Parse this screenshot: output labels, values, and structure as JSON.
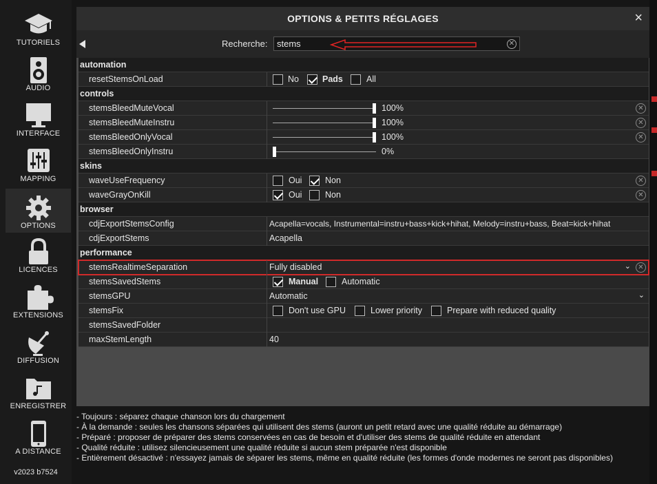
{
  "sidebar": {
    "items": [
      {
        "label": "TUTORIELS"
      },
      {
        "label": "AUDIO"
      },
      {
        "label": "INTERFACE"
      },
      {
        "label": "MAPPING"
      },
      {
        "label": "OPTIONS"
      },
      {
        "label": "LICENCES"
      },
      {
        "label": "EXTENSIONS"
      },
      {
        "label": "DIFFUSION"
      },
      {
        "label": "ENREGISTRER"
      },
      {
        "label": "A DISTANCE"
      }
    ],
    "version": "v2023 b7524"
  },
  "dialog": {
    "title": "OPTIONS & PETITS RÉGLAGES",
    "close": "×",
    "search_label": "Recherche:",
    "search_value": "stems",
    "search_clear": "✕"
  },
  "sections": {
    "automation": "automation",
    "controls": "controls",
    "skins": "skins",
    "browser": "browser",
    "performance": "performance"
  },
  "rows": {
    "resetStemsOnLoad": {
      "name": "resetStemsOnLoad",
      "opt1": "No",
      "opt2": "Pads",
      "opt3": "All"
    },
    "stemsBleedMuteVocal": {
      "name": "stemsBleedMuteVocal",
      "value": "100%",
      "level": 1.0
    },
    "stemsBleedMuteInstru": {
      "name": "stemsBleedMuteInstru",
      "value": "100%",
      "level": 1.0
    },
    "stemsBleedOnlyVocal": {
      "name": "stemsBleedOnlyVocal",
      "value": "100%",
      "level": 1.0
    },
    "stemsBleedOnlyInstru": {
      "name": "stemsBleedOnlyInstru",
      "value": "0%",
      "level": 0.0
    },
    "waveUseFrequency": {
      "name": "waveUseFrequency",
      "opt1": "Oui",
      "opt2": "Non"
    },
    "waveGrayOnKill": {
      "name": "waveGrayOnKill",
      "opt1": "Oui",
      "opt2": "Non"
    },
    "cdjExportStemsConfig": {
      "name": "cdjExportStemsConfig",
      "value": "Acapella=vocals, Instrumental=instru+bass+kick+hihat, Melody=instru+bass, Beat=kick+hihat"
    },
    "cdjExportStems": {
      "name": "cdjExportStems",
      "value": "Acapella"
    },
    "stemsRealtimeSeparation": {
      "name": "stemsRealtimeSeparation",
      "value": "Fully disabled"
    },
    "stemsSavedStems": {
      "name": "stemsSavedStems",
      "opt1": "Manual",
      "opt2": "Automatic"
    },
    "stemsGPU": {
      "name": "stemsGPU",
      "value": "Automatic"
    },
    "stemsFix": {
      "name": "stemsFix",
      "opt1": "Don't use GPU",
      "opt2": "Lower priority",
      "opt3": "Prepare with reduced quality"
    },
    "stemsSavedFolder": {
      "name": "stemsSavedFolder",
      "value": ""
    },
    "maxStemLength": {
      "name": "maxStemLength",
      "value": "40"
    }
  },
  "help": {
    "line1": "- Toujours : séparez chaque chanson lors du chargement",
    "line2": "- À la demande : seules les chansons séparées qui utilisent des stems (auront un petit retard avec une qualité réduite au démarrage)",
    "line3": "- Préparé : proposer de préparer des stems conservées en cas de besoin et d'utiliser des stems de qualité réduite en attendant",
    "line4": "- Qualité réduite : utilisez silencieusement une qualité réduite si aucun stem préparée n'est disponible",
    "line5": "- Entièrement désactivé : n'essayez jamais de séparer les stems, même en qualité réduite (les formes d'onde modernes ne seront pas disponibles)"
  },
  "icons": {
    "reset": "✕",
    "chevron": "⌄"
  },
  "colors": {
    "highlight": "#d12a2a",
    "annotation_arrow": "#e02424"
  }
}
